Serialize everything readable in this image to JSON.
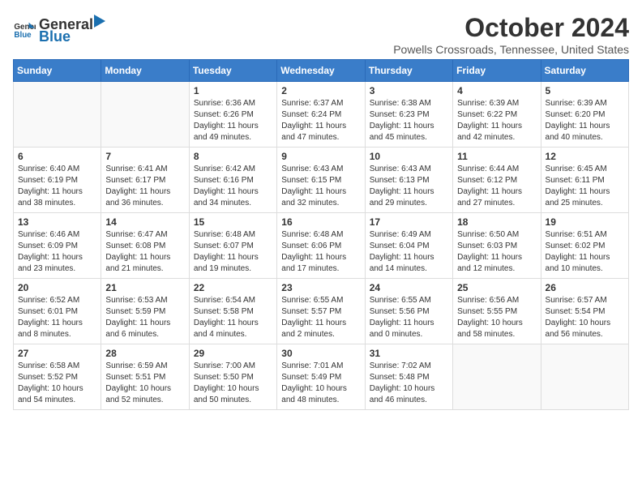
{
  "header": {
    "logo_general": "General",
    "logo_blue": "Blue",
    "month_title": "October 2024",
    "location": "Powells Crossroads, Tennessee, United States"
  },
  "days_of_week": [
    "Sunday",
    "Monday",
    "Tuesday",
    "Wednesday",
    "Thursday",
    "Friday",
    "Saturday"
  ],
  "weeks": [
    [
      {
        "day": "",
        "detail": ""
      },
      {
        "day": "",
        "detail": ""
      },
      {
        "day": "1",
        "detail": "Sunrise: 6:36 AM\nSunset: 6:26 PM\nDaylight: 11 hours and 49 minutes."
      },
      {
        "day": "2",
        "detail": "Sunrise: 6:37 AM\nSunset: 6:24 PM\nDaylight: 11 hours and 47 minutes."
      },
      {
        "day": "3",
        "detail": "Sunrise: 6:38 AM\nSunset: 6:23 PM\nDaylight: 11 hours and 45 minutes."
      },
      {
        "day": "4",
        "detail": "Sunrise: 6:39 AM\nSunset: 6:22 PM\nDaylight: 11 hours and 42 minutes."
      },
      {
        "day": "5",
        "detail": "Sunrise: 6:39 AM\nSunset: 6:20 PM\nDaylight: 11 hours and 40 minutes."
      }
    ],
    [
      {
        "day": "6",
        "detail": "Sunrise: 6:40 AM\nSunset: 6:19 PM\nDaylight: 11 hours and 38 minutes."
      },
      {
        "day": "7",
        "detail": "Sunrise: 6:41 AM\nSunset: 6:17 PM\nDaylight: 11 hours and 36 minutes."
      },
      {
        "day": "8",
        "detail": "Sunrise: 6:42 AM\nSunset: 6:16 PM\nDaylight: 11 hours and 34 minutes."
      },
      {
        "day": "9",
        "detail": "Sunrise: 6:43 AM\nSunset: 6:15 PM\nDaylight: 11 hours and 32 minutes."
      },
      {
        "day": "10",
        "detail": "Sunrise: 6:43 AM\nSunset: 6:13 PM\nDaylight: 11 hours and 29 minutes."
      },
      {
        "day": "11",
        "detail": "Sunrise: 6:44 AM\nSunset: 6:12 PM\nDaylight: 11 hours and 27 minutes."
      },
      {
        "day": "12",
        "detail": "Sunrise: 6:45 AM\nSunset: 6:11 PM\nDaylight: 11 hours and 25 minutes."
      }
    ],
    [
      {
        "day": "13",
        "detail": "Sunrise: 6:46 AM\nSunset: 6:09 PM\nDaylight: 11 hours and 23 minutes."
      },
      {
        "day": "14",
        "detail": "Sunrise: 6:47 AM\nSunset: 6:08 PM\nDaylight: 11 hours and 21 minutes."
      },
      {
        "day": "15",
        "detail": "Sunrise: 6:48 AM\nSunset: 6:07 PM\nDaylight: 11 hours and 19 minutes."
      },
      {
        "day": "16",
        "detail": "Sunrise: 6:48 AM\nSunset: 6:06 PM\nDaylight: 11 hours and 17 minutes."
      },
      {
        "day": "17",
        "detail": "Sunrise: 6:49 AM\nSunset: 6:04 PM\nDaylight: 11 hours and 14 minutes."
      },
      {
        "day": "18",
        "detail": "Sunrise: 6:50 AM\nSunset: 6:03 PM\nDaylight: 11 hours and 12 minutes."
      },
      {
        "day": "19",
        "detail": "Sunrise: 6:51 AM\nSunset: 6:02 PM\nDaylight: 11 hours and 10 minutes."
      }
    ],
    [
      {
        "day": "20",
        "detail": "Sunrise: 6:52 AM\nSunset: 6:01 PM\nDaylight: 11 hours and 8 minutes."
      },
      {
        "day": "21",
        "detail": "Sunrise: 6:53 AM\nSunset: 5:59 PM\nDaylight: 11 hours and 6 minutes."
      },
      {
        "day": "22",
        "detail": "Sunrise: 6:54 AM\nSunset: 5:58 PM\nDaylight: 11 hours and 4 minutes."
      },
      {
        "day": "23",
        "detail": "Sunrise: 6:55 AM\nSunset: 5:57 PM\nDaylight: 11 hours and 2 minutes."
      },
      {
        "day": "24",
        "detail": "Sunrise: 6:55 AM\nSunset: 5:56 PM\nDaylight: 11 hours and 0 minutes."
      },
      {
        "day": "25",
        "detail": "Sunrise: 6:56 AM\nSunset: 5:55 PM\nDaylight: 10 hours and 58 minutes."
      },
      {
        "day": "26",
        "detail": "Sunrise: 6:57 AM\nSunset: 5:54 PM\nDaylight: 10 hours and 56 minutes."
      }
    ],
    [
      {
        "day": "27",
        "detail": "Sunrise: 6:58 AM\nSunset: 5:52 PM\nDaylight: 10 hours and 54 minutes."
      },
      {
        "day": "28",
        "detail": "Sunrise: 6:59 AM\nSunset: 5:51 PM\nDaylight: 10 hours and 52 minutes."
      },
      {
        "day": "29",
        "detail": "Sunrise: 7:00 AM\nSunset: 5:50 PM\nDaylight: 10 hours and 50 minutes."
      },
      {
        "day": "30",
        "detail": "Sunrise: 7:01 AM\nSunset: 5:49 PM\nDaylight: 10 hours and 48 minutes."
      },
      {
        "day": "31",
        "detail": "Sunrise: 7:02 AM\nSunset: 5:48 PM\nDaylight: 10 hours and 46 minutes."
      },
      {
        "day": "",
        "detail": ""
      },
      {
        "day": "",
        "detail": ""
      }
    ]
  ]
}
